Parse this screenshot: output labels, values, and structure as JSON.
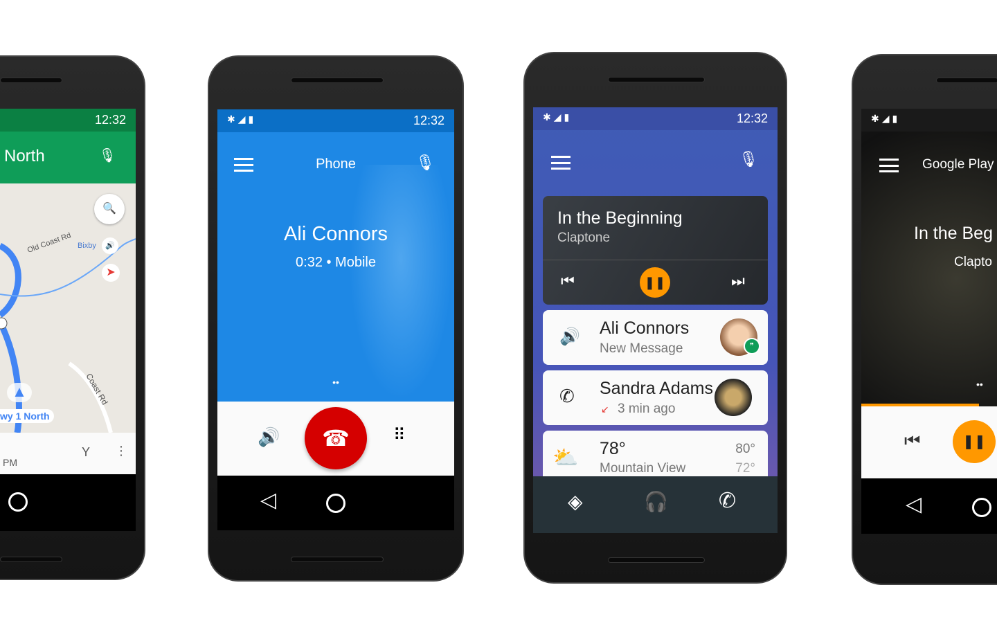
{
  "status_time": "12:32",
  "maps": {
    "heading": "North",
    "roads": [
      "Old Coast Rd",
      "Bixby",
      "Coast Rd"
    ],
    "route_label": "wy 1 North",
    "eta_fragment": "PM",
    "colors": {
      "header": "#0f9d58",
      "route": "#4285f4"
    }
  },
  "phone": {
    "title": "Phone",
    "caller": "Ali Connors",
    "call_info": "0:32 • Mobile",
    "colors": {
      "bg": "#1e88e5",
      "end_call": "#d50000"
    }
  },
  "home": {
    "music": {
      "title": "In the Beginning",
      "artist": "Claptone"
    },
    "cards": [
      {
        "name": "Ali Connors",
        "detail": "New Message"
      },
      {
        "name": "Sandra Adams",
        "detail": "3 min ago"
      }
    ],
    "weather": {
      "temp": "78°",
      "location": "Mountain View",
      "high": "80°",
      "low": "72°"
    },
    "colors": {
      "bg": "#3f5cb5",
      "accent": "#ff9800"
    }
  },
  "music": {
    "app_title": "Google Play",
    "title_fragment": "In the Beg",
    "artist_fragment": "Clapto",
    "colors": {
      "accent": "#ff9800"
    }
  }
}
